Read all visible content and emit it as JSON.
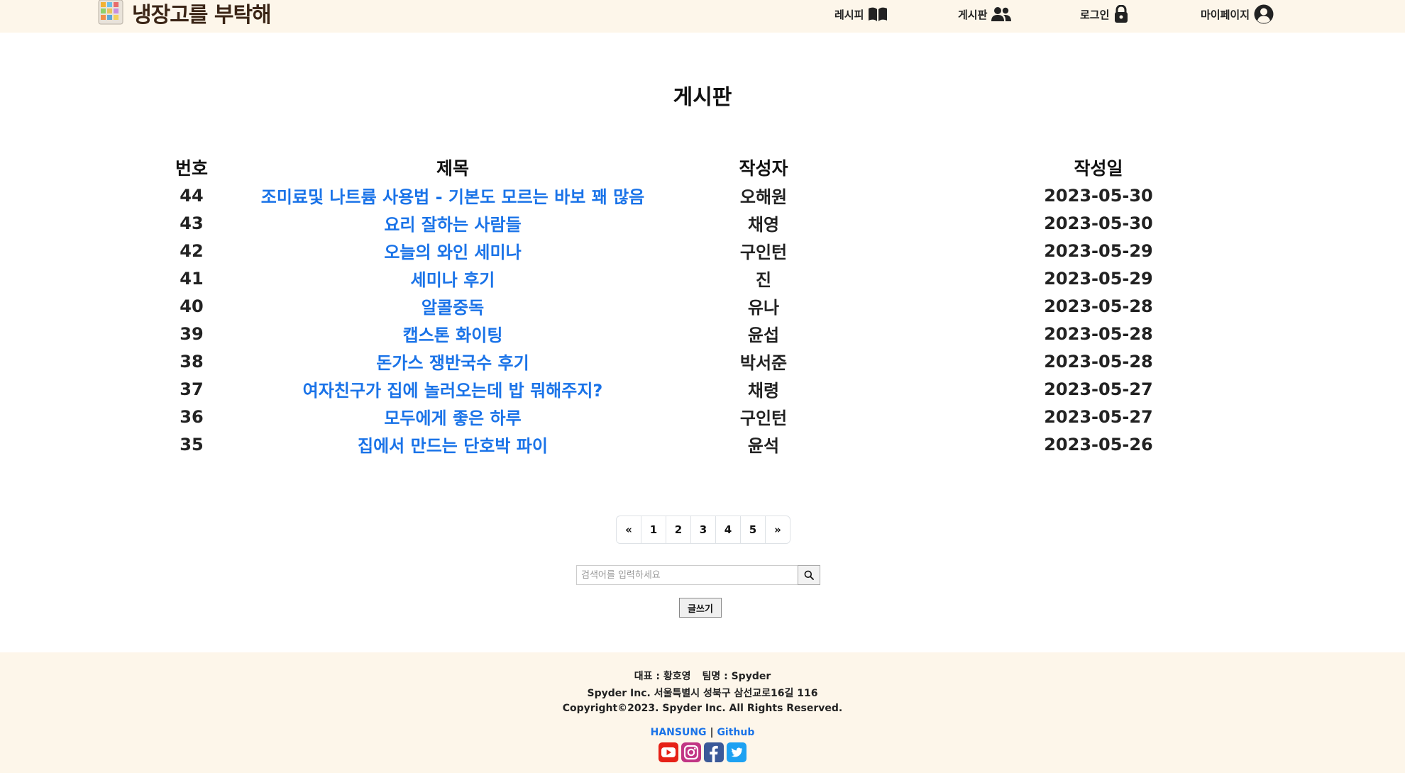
{
  "header": {
    "logo_text": "냉장고를 부탁해",
    "nav": [
      {
        "label": "레시피",
        "icon": "book-open-icon"
      },
      {
        "label": "게시판",
        "icon": "users-icon"
      },
      {
        "label": "로그인",
        "icon": "lock-icon"
      },
      {
        "label": "마이페이지",
        "icon": "user-circle-icon"
      }
    ]
  },
  "page": {
    "title": "게시판"
  },
  "table": {
    "headers": {
      "no": "번호",
      "title": "제목",
      "author": "작성자",
      "date": "작성일"
    },
    "rows": [
      {
        "no": "44",
        "title": "조미료및 나트륨 사용법 - 기본도 모르는 바보 꽤 많음",
        "author": "오해원",
        "date": "2023-05-30"
      },
      {
        "no": "43",
        "title": "요리 잘하는 사람들",
        "author": "채영",
        "date": "2023-05-30"
      },
      {
        "no": "42",
        "title": "오늘의 와인 세미나",
        "author": "구인턴",
        "date": "2023-05-29"
      },
      {
        "no": "41",
        "title": "세미나 후기",
        "author": "진",
        "date": "2023-05-29"
      },
      {
        "no": "40",
        "title": "알콜중독",
        "author": "유나",
        "date": "2023-05-28"
      },
      {
        "no": "39",
        "title": "캡스톤 화이팅",
        "author": "윤섭",
        "date": "2023-05-28"
      },
      {
        "no": "38",
        "title": "돈가스 쟁반국수 후기",
        "author": "박서준",
        "date": "2023-05-28"
      },
      {
        "no": "37",
        "title": "여자친구가 집에 놀러오는데 밥 뭐해주지?",
        "author": "채령",
        "date": "2023-05-27"
      },
      {
        "no": "36",
        "title": "모두에게 좋은 하루",
        "author": "구인턴",
        "date": "2023-05-27"
      },
      {
        "no": "35",
        "title": "집에서 만드는 단호박 파이",
        "author": "윤석",
        "date": "2023-05-26"
      }
    ]
  },
  "pagination": {
    "prev": "«",
    "pages": [
      "1",
      "2",
      "3",
      "4",
      "5"
    ],
    "next": "»"
  },
  "search": {
    "placeholder": "검색어를 입력하세요",
    "value": "",
    "button_icon": "search-icon"
  },
  "write_button": "글쓰기",
  "footer": {
    "rep": "대표 : 황호영",
    "team": "팀명 : Spyder",
    "address": "Spyder Inc. 서울특별시 성북구 삼선교로16길 116",
    "copyright": "Copyright©2023. Spyder Inc. All Rights Reserved.",
    "link1": "HANSUNG",
    "separator": "|",
    "link2": "Github",
    "social_icons": [
      "youtube-icon",
      "instagram-icon",
      "facebook-icon",
      "twitter-icon"
    ]
  },
  "colors": {
    "header_bg": "#fdf6ea",
    "link_blue": "#1a73e8",
    "logo_brown": "#3b2516"
  }
}
